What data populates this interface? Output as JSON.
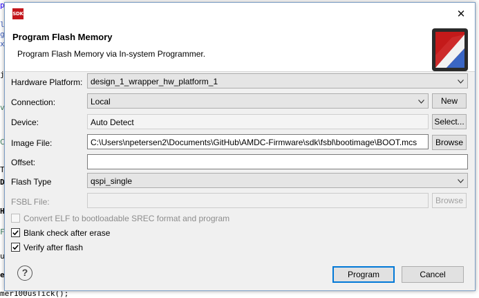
{
  "background": {
    "bottom_line": "mer100usTick();"
  },
  "dialog": {
    "app_icon": "SDK",
    "close_glyph": "✕",
    "title": "Program Flash Memory",
    "description": "Program Flash Memory via In-system Programmer.",
    "hardware_platform": {
      "label": "Hardware Platform:",
      "value": "design_1_wrapper_hw_platform_1"
    },
    "connection": {
      "label": "Connection:",
      "value": "Local",
      "new_button": "New"
    },
    "device": {
      "label": "Device:",
      "value": "Auto Detect",
      "select_button": "Select..."
    },
    "image_file": {
      "label": "Image File:",
      "value": "C:\\Users\\npetersen2\\Documents\\GitHub\\AMDC-Firmware\\sdk\\fsbl\\bootimage\\BOOT.mcs",
      "browse_button": "Browse"
    },
    "offset": {
      "label": "Offset:",
      "value": ""
    },
    "flash_type": {
      "label": "Flash Type",
      "value": "qspi_single"
    },
    "fsbl_file": {
      "label": "FSBL File:",
      "value": "",
      "browse_button": "Browse"
    },
    "options": [
      {
        "label": "Convert ELF to bootloadable SREC format and program",
        "checked": false,
        "enabled": false
      },
      {
        "label": "Blank check after erase",
        "checked": true,
        "enabled": true
      },
      {
        "label": "Verify after flash",
        "checked": true,
        "enabled": true
      }
    ],
    "help_glyph": "?",
    "program_button": "Program",
    "cancel_button": "Cancel"
  }
}
